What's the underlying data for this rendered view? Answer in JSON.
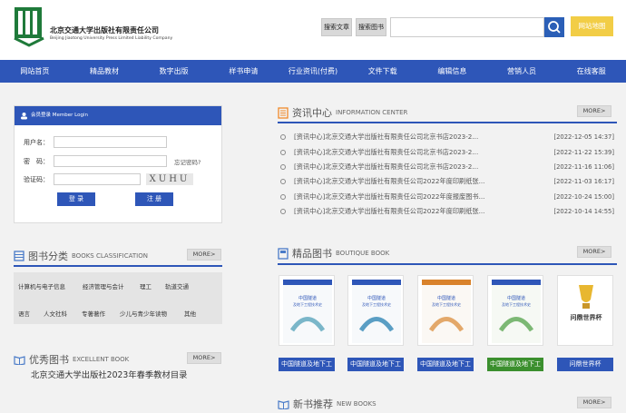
{
  "header": {
    "publisher_cn": "北京交通大学出版社有限责任公司",
    "publisher_en": "Beijing Jiaotong University Press Limited Liability Company",
    "search_article": "搜索文章",
    "search_book": "搜索图书",
    "site_map": "网站地图"
  },
  "nav": [
    "网站首页",
    "精品教材",
    "数字出版",
    "样书申请",
    "行业资讯(付费)",
    "文件下载",
    "编辑信息",
    "营销人员",
    "在线客服"
  ],
  "login": {
    "title": "会员登录 Member Login",
    "username": "用户名：",
    "password": "密　码：",
    "forgot": "忘记密码?",
    "captcha_label": "验证码：",
    "captcha": "XUHU",
    "login_btn": "登 录",
    "register_btn": "注 册"
  },
  "info": {
    "cn": "资讯中心",
    "en": "INFORMATION CENTER",
    "more": "MORE>",
    "items": [
      {
        "title": "[资讯中心]北京交通大学出版社有限责任公司北京书店2023-2...",
        "date": "[2022-12-05 14:37]"
      },
      {
        "title": "[资讯中心]北京交通大学出版社有限责任公司北京书店2023-2...",
        "date": "[2022-11-22 15:39]"
      },
      {
        "title": "[资讯中心]北京交通大学出版社有限责任公司北京书店2023-2...",
        "date": "[2022-11-16 11:06]"
      },
      {
        "title": "[资讯中心]北京交通大学出版社有限责任公司2022年度印刷纸张...",
        "date": "[2022-11-03 16:17]"
      },
      {
        "title": "[资讯中心]北京交通大学出版社有限责任公司2022年度报废图书...",
        "date": "[2022-10-24 15:00]"
      },
      {
        "title": "[资讯中心]北京交通大学出版社有限责任公司2022年度印刷纸张...",
        "date": "[2022-10-14 14:55]"
      }
    ]
  },
  "classify": {
    "cn": "图书分类",
    "en": "BOOKS CLASSIFICATION",
    "more": "MORE>",
    "row1": [
      "计算机与电子信息",
      "经济管理与会计",
      "理工",
      "轨道交通"
    ],
    "row2": [
      "语言",
      "人文社科",
      "专著著作",
      "少儿与青少年读物",
      "其他"
    ]
  },
  "boutique": {
    "cn": "精品图书",
    "en": "BOUTIQUE BOOK",
    "more": "MORE>",
    "books": [
      {
        "label": "中国隧道及地下工",
        "color": "#2e56b8",
        "cover": "中国隧道及地下工程技术史"
      },
      {
        "label": "中国隧道及地下工",
        "color": "#2e56b8",
        "cover": "中国隧道及地下工程技术史"
      },
      {
        "label": "中国隧道及地下工",
        "color": "#2e56b8",
        "cover": "中国隧道及地下工程技术史"
      },
      {
        "label": "中国隧道及地下工",
        "color": "#3b8f2e",
        "cover": "中国隧道及地下工程技术史"
      },
      {
        "label": "问鼎世界杯",
        "color": "#2e56b8",
        "cover": "问鼎世界杯"
      }
    ]
  },
  "excellent": {
    "cn": "优秀图书",
    "en": "EXCELLENT BOOK",
    "more": "MORE>",
    "item": "北京交通大学出版社2023年春季教材目录"
  },
  "newbooks": {
    "cn": "新书推荐",
    "en": "NEW BOOKS",
    "more": "MORE>"
  },
  "colors": {
    "primary": "#2e56b8",
    "accent": "#f2cd46",
    "green": "#3b8f2e"
  }
}
